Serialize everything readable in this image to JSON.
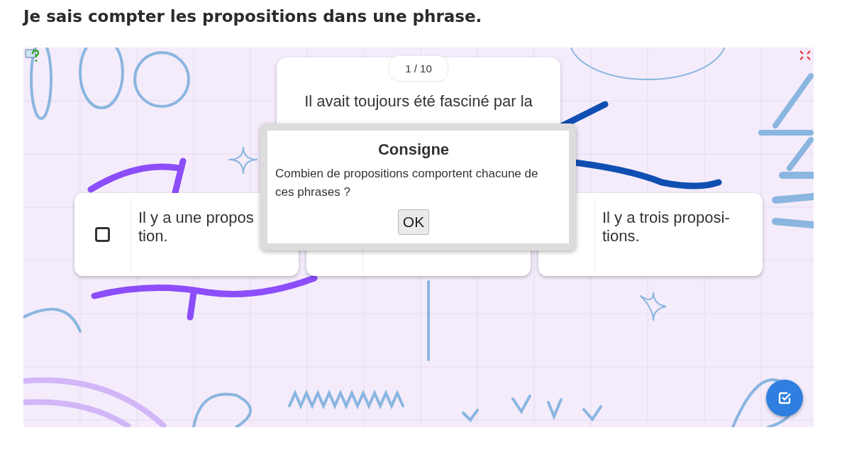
{
  "page_title": "Je sais compter les propositions dans une phrase.",
  "activity": {
    "counter": "1 / 10",
    "question": "Il avait toujours été fasciné par la",
    "answers": [
      {
        "kind": "text",
        "lines": [
          "Il y a une propos",
          "tion."
        ],
        "checkbox": {
          "checked": false
        }
      },
      {
        "kind": "covered"
      },
      {
        "kind": "text",
        "lines": [
          "Il y a trois proposi-",
          "tions."
        ]
      }
    ]
  },
  "dialog": {
    "title": "Consigne",
    "message": "Combien de propositions comportent chacune de ces phrases ?",
    "button": "OK"
  }
}
